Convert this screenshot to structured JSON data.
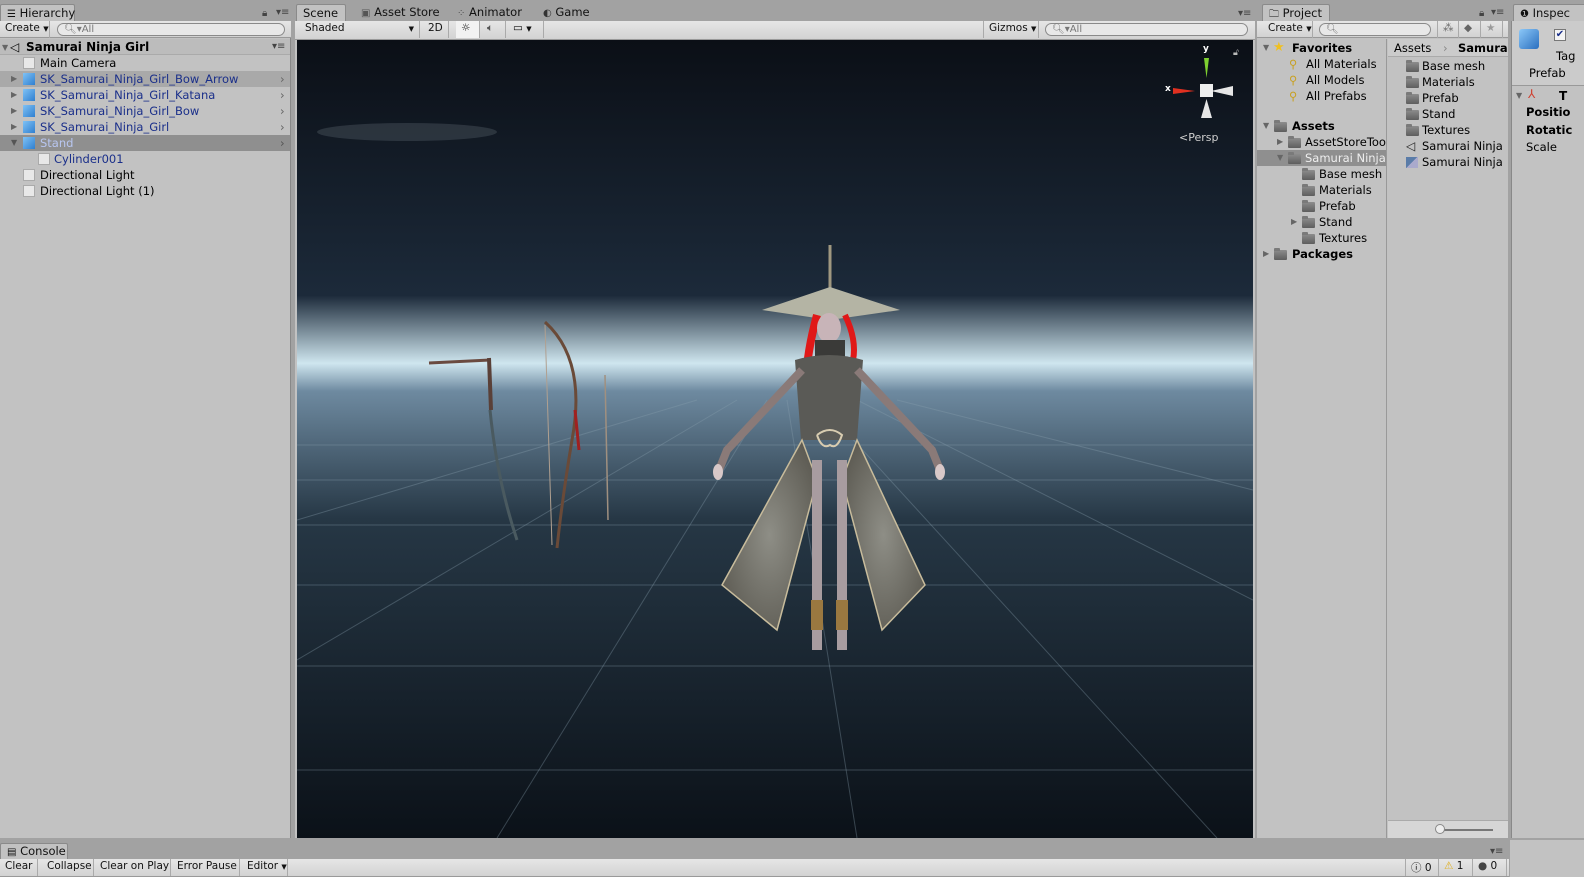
{
  "hierarchy": {
    "tab_label": "Hierarchy",
    "create_label": "Create",
    "search_placeholder": "All",
    "scene_name": "Samurai Ninja Girl",
    "items": [
      {
        "label": "Main Camera",
        "type": "gameobject",
        "prefab": false
      },
      {
        "label": "SK_Samurai_Ninja_Girl_Bow_Arrow",
        "type": "prefab",
        "prefab": true
      },
      {
        "label": "SK_Samurai_Ninja_Girl_Katana",
        "type": "prefab",
        "prefab": true
      },
      {
        "label": "SK_Samurai_Ninja_Girl_Bow",
        "type": "prefab",
        "prefab": true
      },
      {
        "label": "SK_Samurai_Ninja_Girl",
        "type": "prefab",
        "prefab": true
      },
      {
        "label": "Stand",
        "type": "prefab",
        "prefab": true,
        "selected": true,
        "expanded": true
      },
      {
        "label": "Cylinder001",
        "type": "child",
        "prefab": true
      },
      {
        "label": "Directional Light",
        "type": "gameobject",
        "prefab": false
      },
      {
        "label": "Directional Light (1)",
        "type": "gameobject",
        "prefab": false
      }
    ]
  },
  "scene_view": {
    "tabs": [
      {
        "label": "Scene",
        "icon": "scene-icon",
        "active": true
      },
      {
        "label": "Asset Store",
        "icon": "store-icon",
        "active": false
      },
      {
        "label": "Animator",
        "icon": "animator-icon",
        "active": false
      },
      {
        "label": "Game",
        "icon": "game-icon",
        "active": false
      }
    ],
    "draw_mode": "Shaded",
    "mode_2d": "2D",
    "gizmos_label": "Gizmos",
    "search_placeholder": "All",
    "gizmo_axis_x": "x",
    "gizmo_axis_y": "y",
    "projection": "Persp"
  },
  "project": {
    "tab_label": "Project",
    "create_label": "Create",
    "search_placeholder": "",
    "favorites_label": "Favorites",
    "favorites": [
      "All Materials",
      "All Models",
      "All Prefabs"
    ],
    "assets_label": "Assets",
    "asset_tree": [
      {
        "label": "AssetStoreToo",
        "level": 1,
        "collapsed": true
      },
      {
        "label": "Samurai Ninja",
        "level": 1,
        "expanded": true,
        "selected": true
      },
      {
        "label": "Base mesh",
        "level": 2
      },
      {
        "label": "Materials",
        "level": 2
      },
      {
        "label": "Prefab",
        "level": 2
      },
      {
        "label": "Stand",
        "level": 2,
        "collapsed": true
      },
      {
        "label": "Textures",
        "level": 2
      }
    ],
    "packages_label": "Packages",
    "breadcrumb": [
      "Assets",
      "Samurai"
    ],
    "contents": [
      {
        "label": "Base mesh",
        "icon": "folder-icon"
      },
      {
        "label": "Materials",
        "icon": "folder-icon"
      },
      {
        "label": "Prefab",
        "icon": "folder-icon"
      },
      {
        "label": "Stand",
        "icon": "folder-icon"
      },
      {
        "label": "Textures",
        "icon": "folder-icon"
      },
      {
        "label": "Samurai Ninja",
        "icon": "unity-scene-icon"
      },
      {
        "label": "Samurai Ninja",
        "icon": "lighting-data-icon"
      }
    ]
  },
  "inspector": {
    "tab_label": "Inspec",
    "tag_label": "Tag",
    "prefab_label": "Prefab",
    "transform_label": "T",
    "position_label": "Positio",
    "rotation_label": "Rotatic",
    "scale_label": "Scale"
  },
  "console": {
    "tab_label": "Console",
    "buttons": [
      "Clear",
      "Collapse",
      "Clear on Play",
      "Error Pause",
      "Editor"
    ],
    "info_count": "0",
    "warning_count": "1",
    "error_count": "0"
  }
}
